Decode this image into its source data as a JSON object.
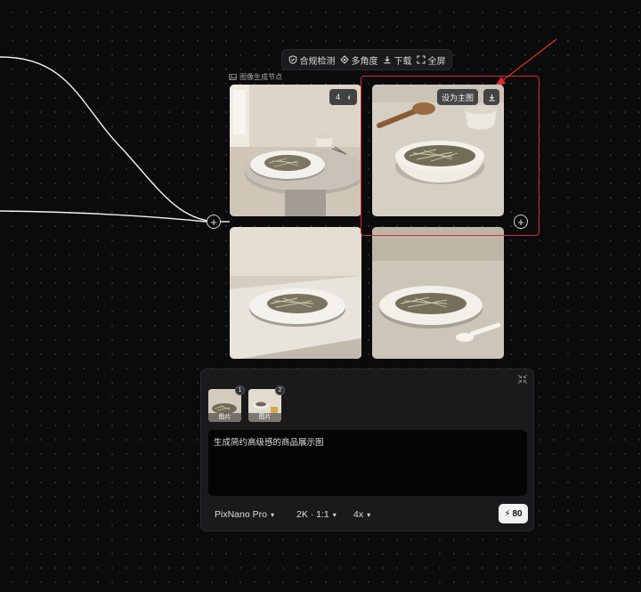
{
  "toolbar": {
    "items": [
      {
        "label": "合规检测",
        "icon": "shield-icon"
      },
      {
        "label": "多角度",
        "icon": "angles-icon"
      },
      {
        "label": "下载",
        "icon": "download-icon"
      },
      {
        "label": "全屏",
        "icon": "fullscreen-icon"
      }
    ]
  },
  "node": {
    "title": "图像生成节点",
    "count": "4",
    "set_main_label": "设为主图"
  },
  "panel": {
    "references": [
      {
        "index": "1",
        "label": "图片"
      },
      {
        "index": "2",
        "label": "图片"
      }
    ],
    "prompt": "生成简约高级感的商品展示图",
    "model": "PixNano Pro",
    "resolution": "2K · 1:1",
    "quantity": "4x",
    "cost": "80"
  },
  "colors": {
    "highlight": "#d92b2b",
    "background": "#0b0b0c"
  }
}
